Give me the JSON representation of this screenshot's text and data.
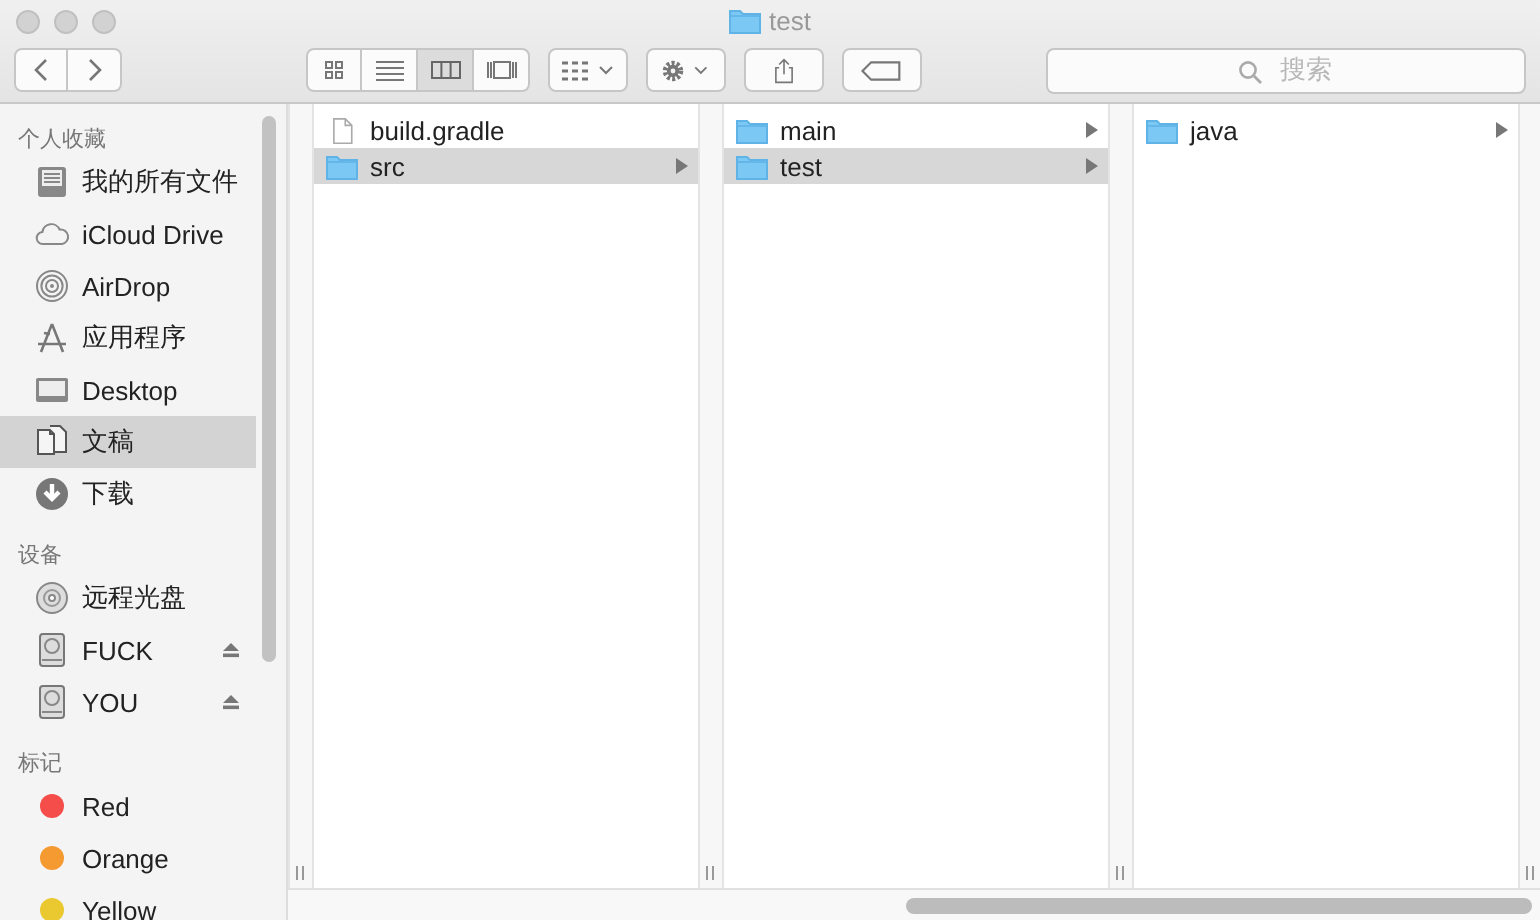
{
  "window": {
    "title": "test"
  },
  "toolbar": {
    "view_modes": [
      {
        "kind": "icons",
        "selected": false
      },
      {
        "kind": "list",
        "selected": false
      },
      {
        "kind": "columns",
        "selected": true
      },
      {
        "kind": "coverflow",
        "selected": false
      }
    ]
  },
  "search": {
    "placeholder": "搜索"
  },
  "sidebar": {
    "sections": [
      {
        "title": "个人收藏",
        "items": [
          {
            "kind": "all-files",
            "label": "我的所有文件",
            "selected": false
          },
          {
            "kind": "cloud",
            "label": "iCloud Drive",
            "selected": false
          },
          {
            "kind": "airdrop",
            "label": "AirDrop",
            "selected": false
          },
          {
            "kind": "apps",
            "label": "应用程序",
            "selected": false
          },
          {
            "kind": "desktop",
            "label": "Desktop",
            "selected": false
          },
          {
            "kind": "documents",
            "label": "文稿",
            "selected": true
          },
          {
            "kind": "downloads",
            "label": "下载",
            "selected": false
          }
        ]
      },
      {
        "title": "设备",
        "items": [
          {
            "kind": "disc",
            "label": "远程光盘",
            "selected": false,
            "ejectable": false
          },
          {
            "kind": "drive",
            "label": "FUCK",
            "selected": false,
            "ejectable": true
          },
          {
            "kind": "drive",
            "label": "YOU",
            "selected": false,
            "ejectable": true
          }
        ]
      },
      {
        "title": "标记",
        "items": [
          {
            "kind": "tag",
            "label": "Red",
            "selected": false,
            "color": "#f54d4a"
          },
          {
            "kind": "tag",
            "label": "Orange",
            "selected": false,
            "color": "#f59a30"
          },
          {
            "kind": "tag",
            "label": "Yellow",
            "selected": false,
            "color": "#e9c92f"
          }
        ]
      }
    ]
  },
  "columns": [
    {
      "items": [
        {
          "kind": "file",
          "name": "build.gradle",
          "selected": false,
          "has_children": false
        },
        {
          "kind": "folder",
          "name": "src",
          "selected": true,
          "has_children": true
        }
      ]
    },
    {
      "items": [
        {
          "kind": "folder",
          "name": "main",
          "selected": false,
          "has_children": true
        },
        {
          "kind": "folder",
          "name": "test",
          "selected": true,
          "has_children": true
        }
      ]
    },
    {
      "items": [
        {
          "kind": "folder",
          "name": "java",
          "selected": false,
          "has_children": true
        }
      ]
    }
  ]
}
